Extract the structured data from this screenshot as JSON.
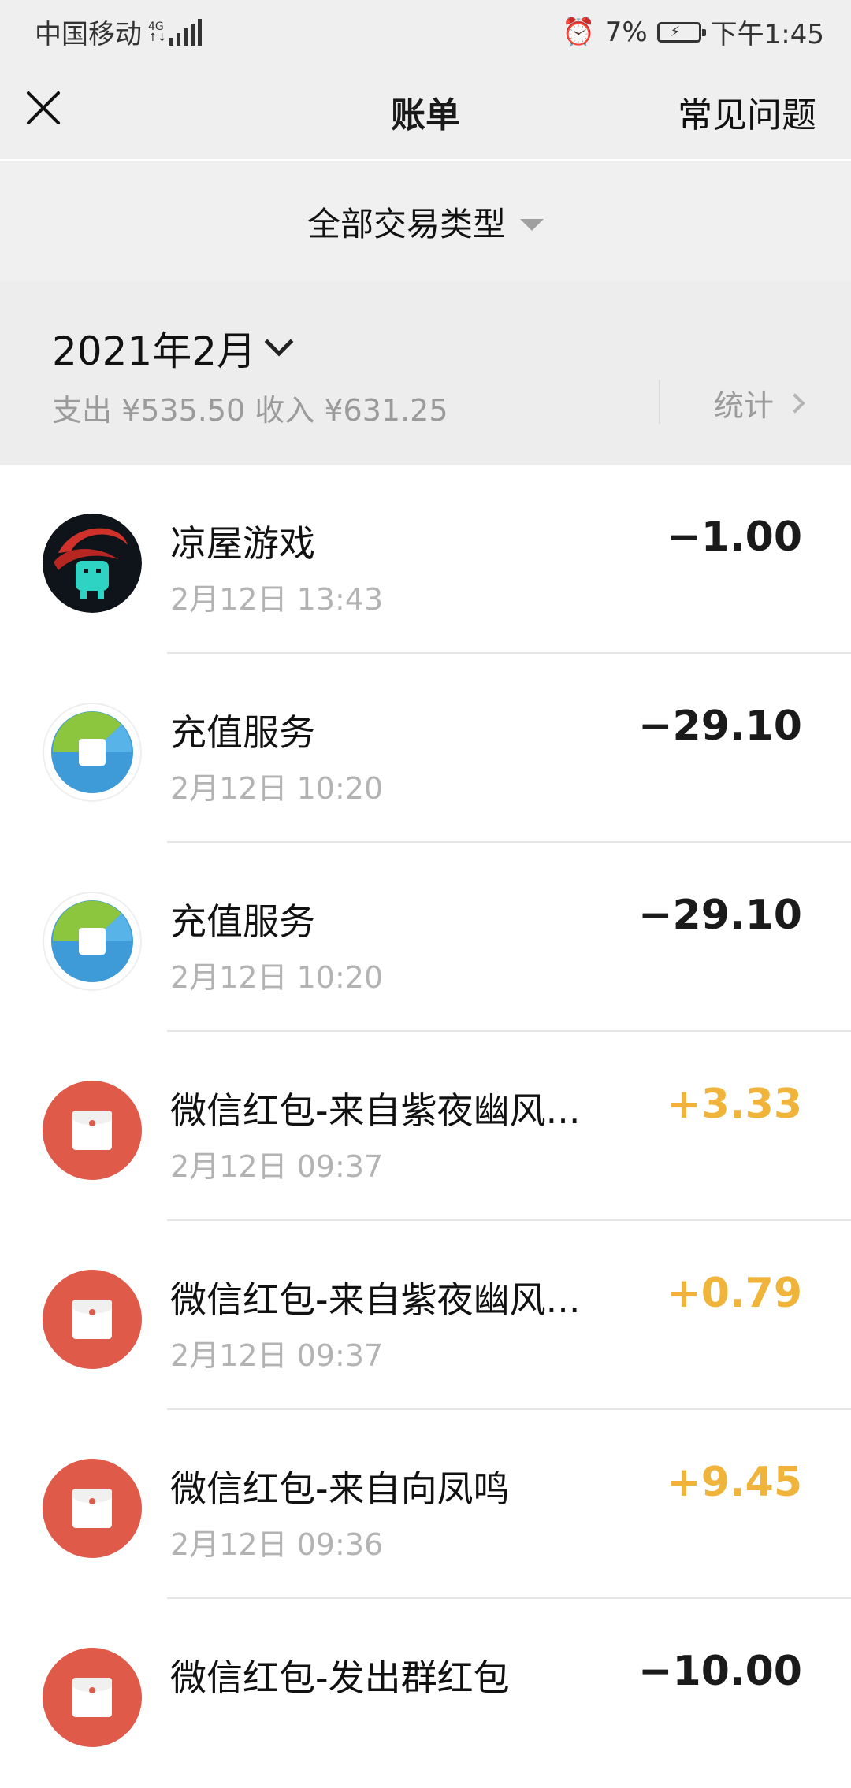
{
  "status_bar": {
    "carrier": "中国移动",
    "network": "4G",
    "battery": "7%",
    "time": "下午1:45"
  },
  "nav": {
    "title": "账单",
    "faq": "常见问题"
  },
  "filter": {
    "label": "全部交易类型"
  },
  "month": {
    "label": "2021年2月",
    "summary": "支出 ¥535.50 收入 ¥631.25",
    "stats": "统计"
  },
  "colors": {
    "income": "#f0b43a",
    "expense": "#1a1a1a",
    "hongbao_red": "#e05a4a"
  },
  "transactions": [
    {
      "name": "凉屋游戏",
      "time": "2月12日 13:43",
      "amount": "−1.00",
      "icon": "game-avatar"
    },
    {
      "name": "充值服务",
      "time": "2月12日 10:20",
      "amount": "−29.10",
      "icon": "recharge-icon"
    },
    {
      "name": "充值服务",
      "time": "2月12日 10:20",
      "amount": "−29.10",
      "icon": "recharge-icon"
    },
    {
      "name": "微信红包-来自紫夜幽风...",
      "time": "2月12日 09:37",
      "amount": "+3.33",
      "icon": "red-envelope-icon"
    },
    {
      "name": "微信红包-来自紫夜幽风...",
      "time": "2月12日 09:37",
      "amount": "+0.79",
      "icon": "red-envelope-icon"
    },
    {
      "name": "微信红包-来自向凤鸣",
      "time": "2月12日 09:36",
      "amount": "+9.45",
      "icon": "red-envelope-icon"
    },
    {
      "name": "微信红包-发出群红包",
      "time": "",
      "amount": "−10.00",
      "icon": "red-envelope-icon"
    }
  ]
}
